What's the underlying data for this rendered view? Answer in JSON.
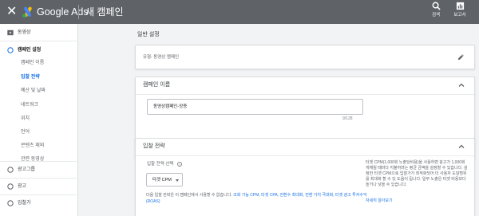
{
  "topbar": {
    "brand": "Google Ads",
    "page_title": "새 캠페인",
    "close_glyph": "✕",
    "tools": [
      {
        "icon": "search-icon",
        "label": "검색"
      },
      {
        "icon": "report-icon",
        "label": "보고서"
      }
    ]
  },
  "colors": {
    "topbar": "#5f6368",
    "accent": "#1a73e8",
    "logo_blue": "#4285f4",
    "logo_yellow": "#fbbc04",
    "logo_green": "#34a853"
  },
  "sidebar": {
    "top_items": [
      {
        "label": "동영상",
        "icon": "video-campaign-icon"
      },
      {
        "label": "캠페인 설정",
        "icon": "step-circle-icon"
      },
      {
        "label": "광고그룹",
        "icon": "step-circle-icon"
      },
      {
        "label": "광고",
        "icon": "step-circle-icon"
      },
      {
        "label": "입찰가",
        "icon": "step-circle-icon"
      }
    ],
    "sub_items": [
      {
        "label": "캠페인 이름",
        "active": false
      },
      {
        "label": "입찰 전략",
        "active": true
      },
      {
        "label": "예산 및 날짜",
        "active": false
      },
      {
        "label": "네트워크",
        "active": false
      },
      {
        "label": "위치",
        "active": false
      },
      {
        "label": "언어",
        "active": false
      },
      {
        "label": "콘텐츠 제외",
        "active": false
      },
      {
        "label": "관련 동영상",
        "active": false
      }
    ]
  },
  "main": {
    "section_title": "일반 설정",
    "type_card": {
      "text": "유형: 동영상 캠페인",
      "edit_icon": "pencil-icon"
    },
    "name_card": {
      "title": "캠페인 이름",
      "input_value": "동영상캠페인-앙증",
      "counter": "9/128",
      "chevron_icon": "chevron-up-icon"
    },
    "bid_card": {
      "title": "입찰 전략",
      "focus_label": "입찰 전략 선택",
      "help_glyph": "?",
      "selected_strategy": "타겟 CPM",
      "description": {
        "lead": "다음 입찰 전략은 이 캠페인에서 사용할 수 없습니다. ",
        "unavailable": "조회 가능 CPM, 타겟 CPA, 전환수 최대화, 전환 가치 극대화, 타겟 광고 투자수익(ROAS)"
      },
      "help_text": "타겟 CPM(1,000회 노출당비용)을 사용하면 광고가 1,000회 게재될 때마다 지불하려는 평균 금액을 설정할 수 있습니다. 설정한 타겟 CPM으로 입찰가가 최적화되어 더 사용자 도달범위를 최대화 할 수 있 도움이 됩니다. 일부 노출은 타겟 비용보다 높거나 낮을 수 있습니다.",
      "learn_more": "자세히 알아보기"
    }
  }
}
